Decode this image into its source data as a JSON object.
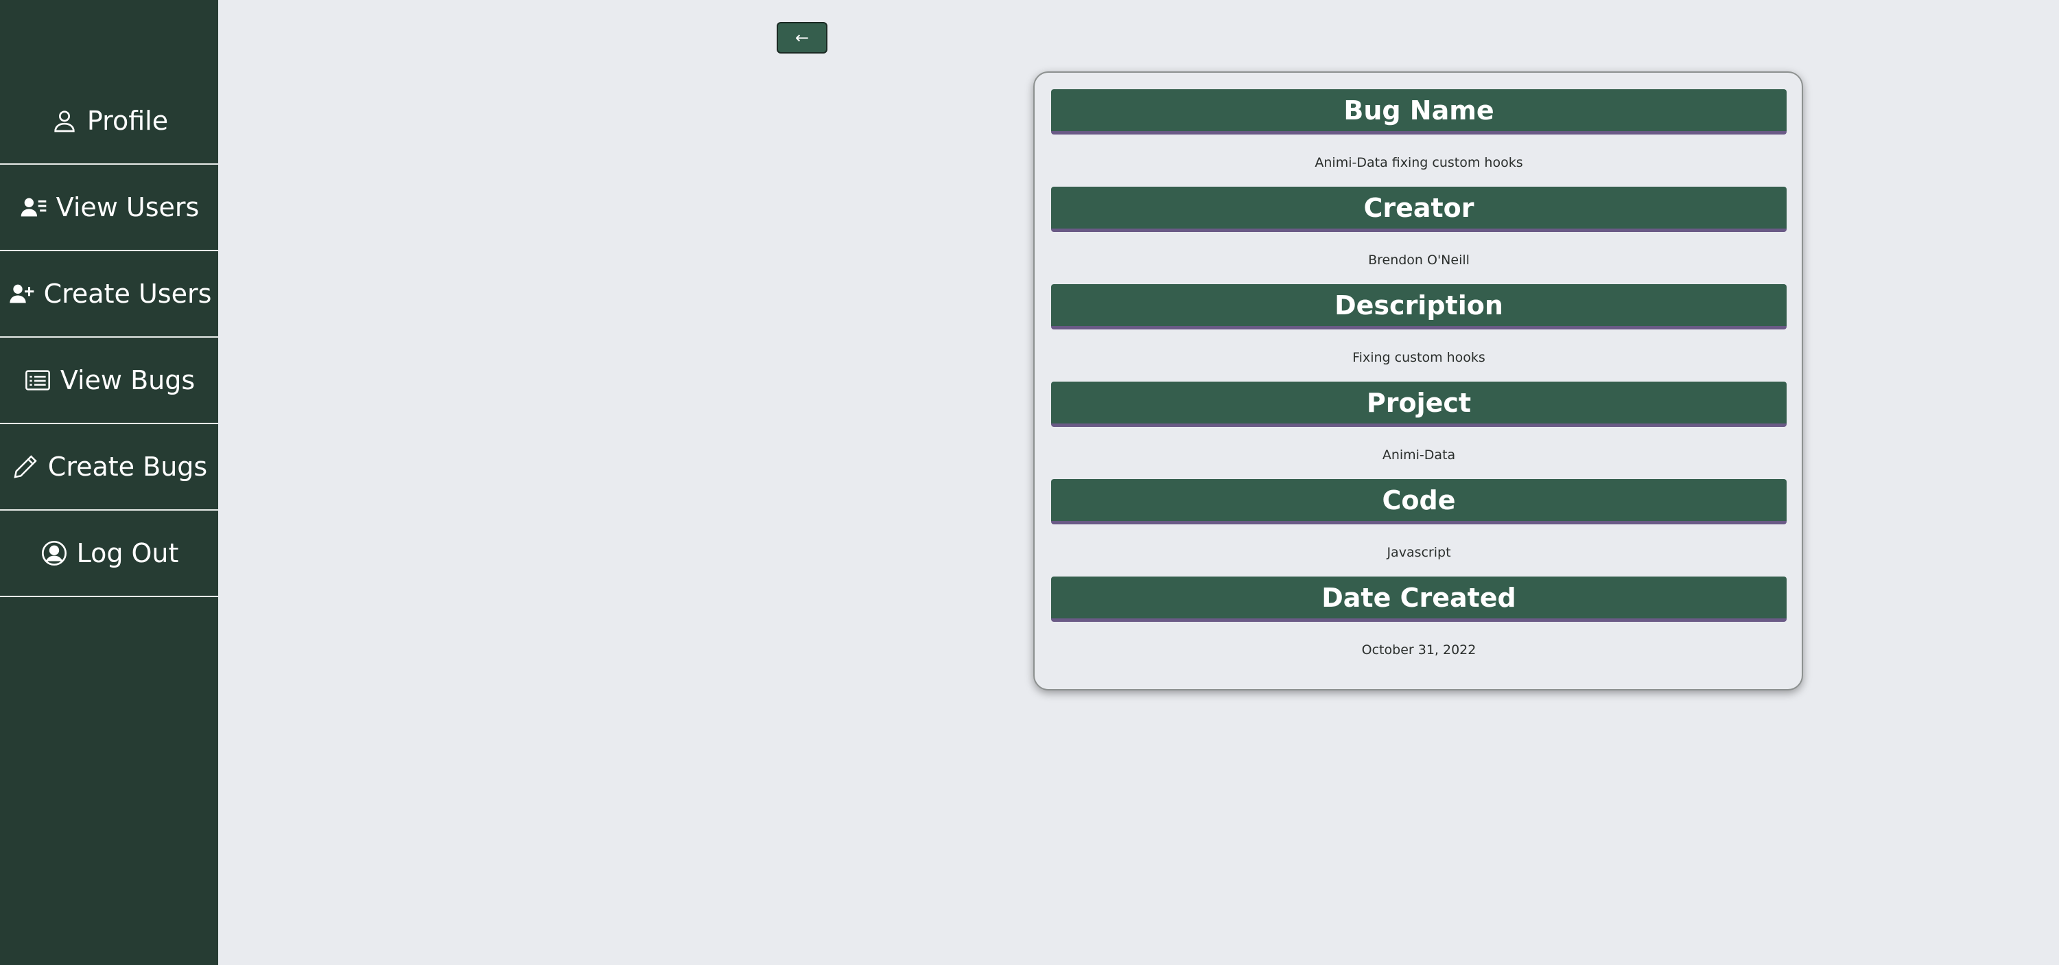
{
  "sidebar": {
    "items": [
      {
        "label": "Profile",
        "icon": "person-icon"
      },
      {
        "label": "View Users",
        "icon": "users-list-icon"
      },
      {
        "label": "Create Users",
        "icon": "user-plus-icon"
      },
      {
        "label": "View Bugs",
        "icon": "list-icon"
      },
      {
        "label": "Create Bugs",
        "icon": "pencil-icon"
      },
      {
        "label": "Log Out",
        "icon": "person-circle-icon"
      }
    ]
  },
  "back_button": {
    "label": "←"
  },
  "bug": {
    "fields": [
      {
        "header": "Bug Name",
        "value": "Animi-Data fixing custom hooks"
      },
      {
        "header": "Creator",
        "value": "Brendon O'Neill"
      },
      {
        "header": "Description",
        "value": "Fixing custom hooks"
      },
      {
        "header": "Project",
        "value": "Animi-Data"
      },
      {
        "header": "Code",
        "value": "Javascript"
      },
      {
        "header": "Date Created",
        "value": "October 31, 2022"
      }
    ]
  },
  "colors": {
    "sidebar_bg": "#263c33",
    "header_bg": "#355e4d",
    "header_underline": "#6a5a86",
    "page_bg": "#e9ebef"
  }
}
